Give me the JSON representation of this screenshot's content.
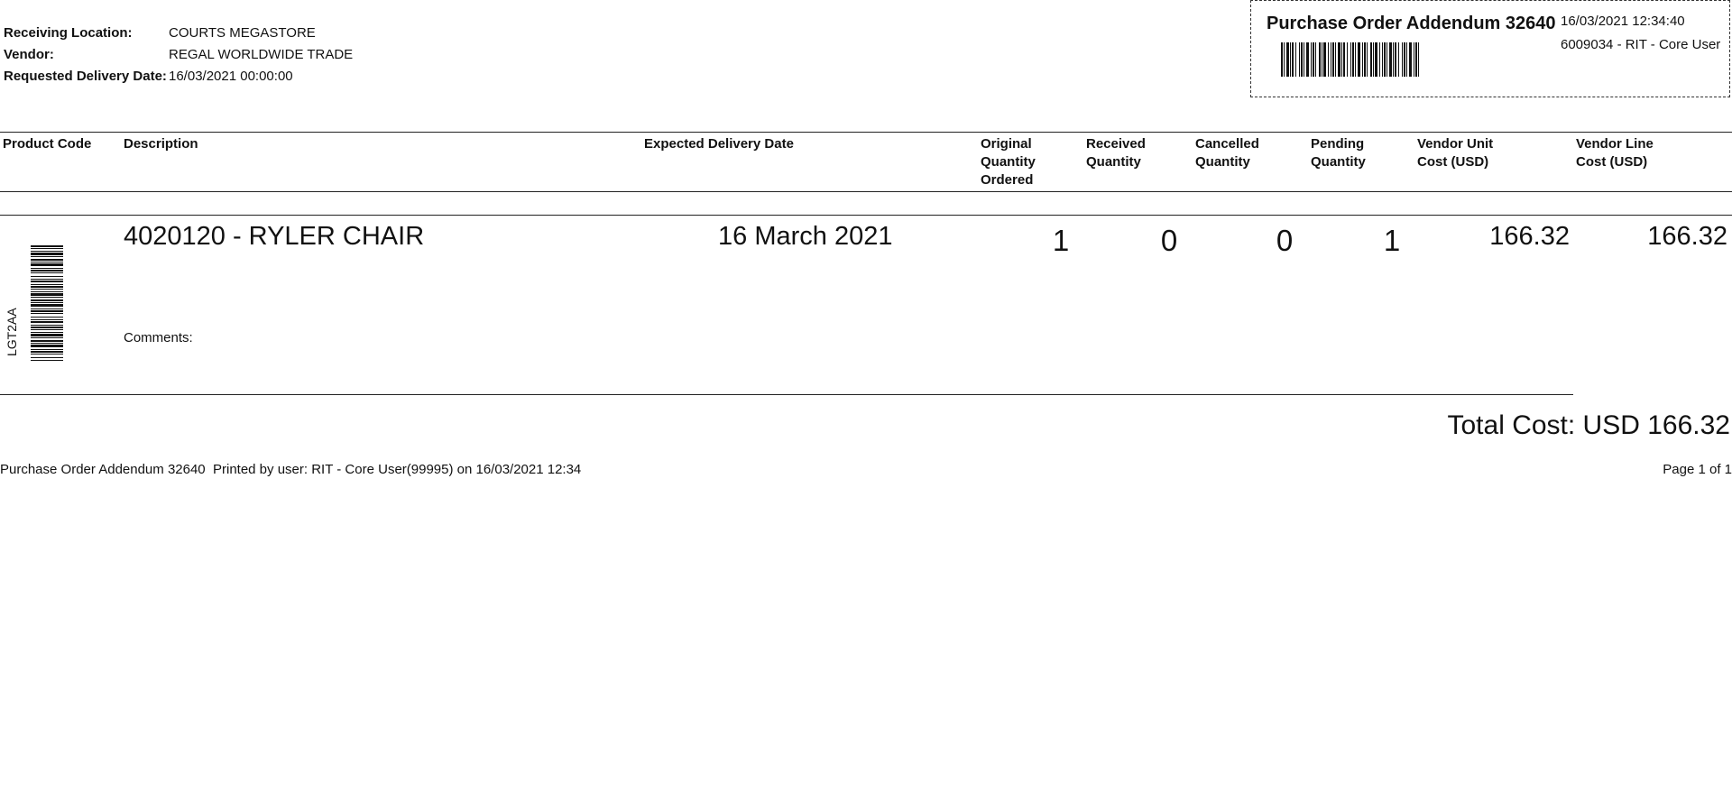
{
  "header": {
    "receiving_location_label": "Receiving Location:",
    "receiving_location_value": "COURTS MEGASTORE",
    "vendor_label": "Vendor:",
    "vendor_value": "REGAL WORLDWIDE TRADE",
    "delivery_label": "Requested Delivery Date:",
    "delivery_value": "16/03/2021 00:00:00"
  },
  "addendum": {
    "title": "Purchase Order Addendum 32640",
    "datetime": "16/03/2021 12:34:40",
    "user": "6009034 - RIT - Core User"
  },
  "columns": {
    "product_code": "Product Code",
    "description": "Description",
    "expected_delivery": "Expected Delivery Date",
    "original_qty": [
      "Original",
      "Quantity",
      "Ordered"
    ],
    "received_qty": [
      "Received",
      "Quantity"
    ],
    "cancelled_qty": [
      "Cancelled",
      "Quantity"
    ],
    "pending_qty": [
      "Pending",
      "Quantity"
    ],
    "unit_cost": [
      "Vendor Unit",
      "Cost (USD)"
    ],
    "line_cost": [
      "Vendor Line",
      "Cost (USD)"
    ]
  },
  "line": {
    "product_code": "LGT2AA",
    "description": "4020120 - RYLER CHAIR",
    "expected_delivery": "16 March 2021",
    "original_qty": "1",
    "received_qty": "0",
    "cancelled_qty": "0",
    "pending_qty": "1",
    "unit_cost": "166.32",
    "line_cost": "166.32",
    "comments_label": "Comments:"
  },
  "total": "Total Cost: USD 166.32",
  "footer": {
    "left": "Purchase Order Addendum 32640  Printed by user: RIT - Core User(99995) on 16/03/2021 12:34",
    "right": "Page 1 of 1"
  }
}
